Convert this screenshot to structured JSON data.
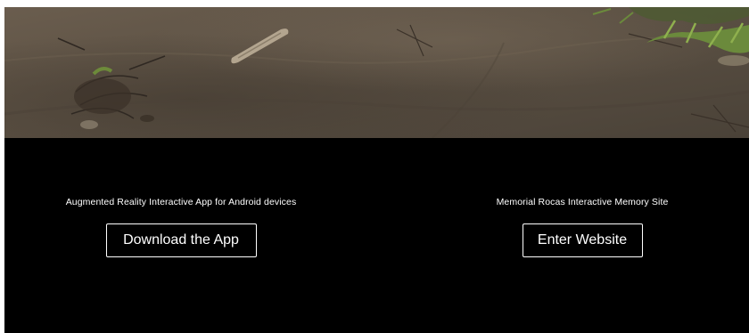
{
  "hero": {
    "image_name": "beach-sand-debris-photo"
  },
  "cta_app": {
    "caption": "Augmented Reality Interactive App for Android devices",
    "button_label": "Download the App"
  },
  "cta_site": {
    "caption": "Memorial Rocas Interactive Memory Site",
    "button_label": "Enter Website"
  },
  "colors": {
    "background": "#000000",
    "text": "#ffffff",
    "sand": "#5e5244"
  }
}
